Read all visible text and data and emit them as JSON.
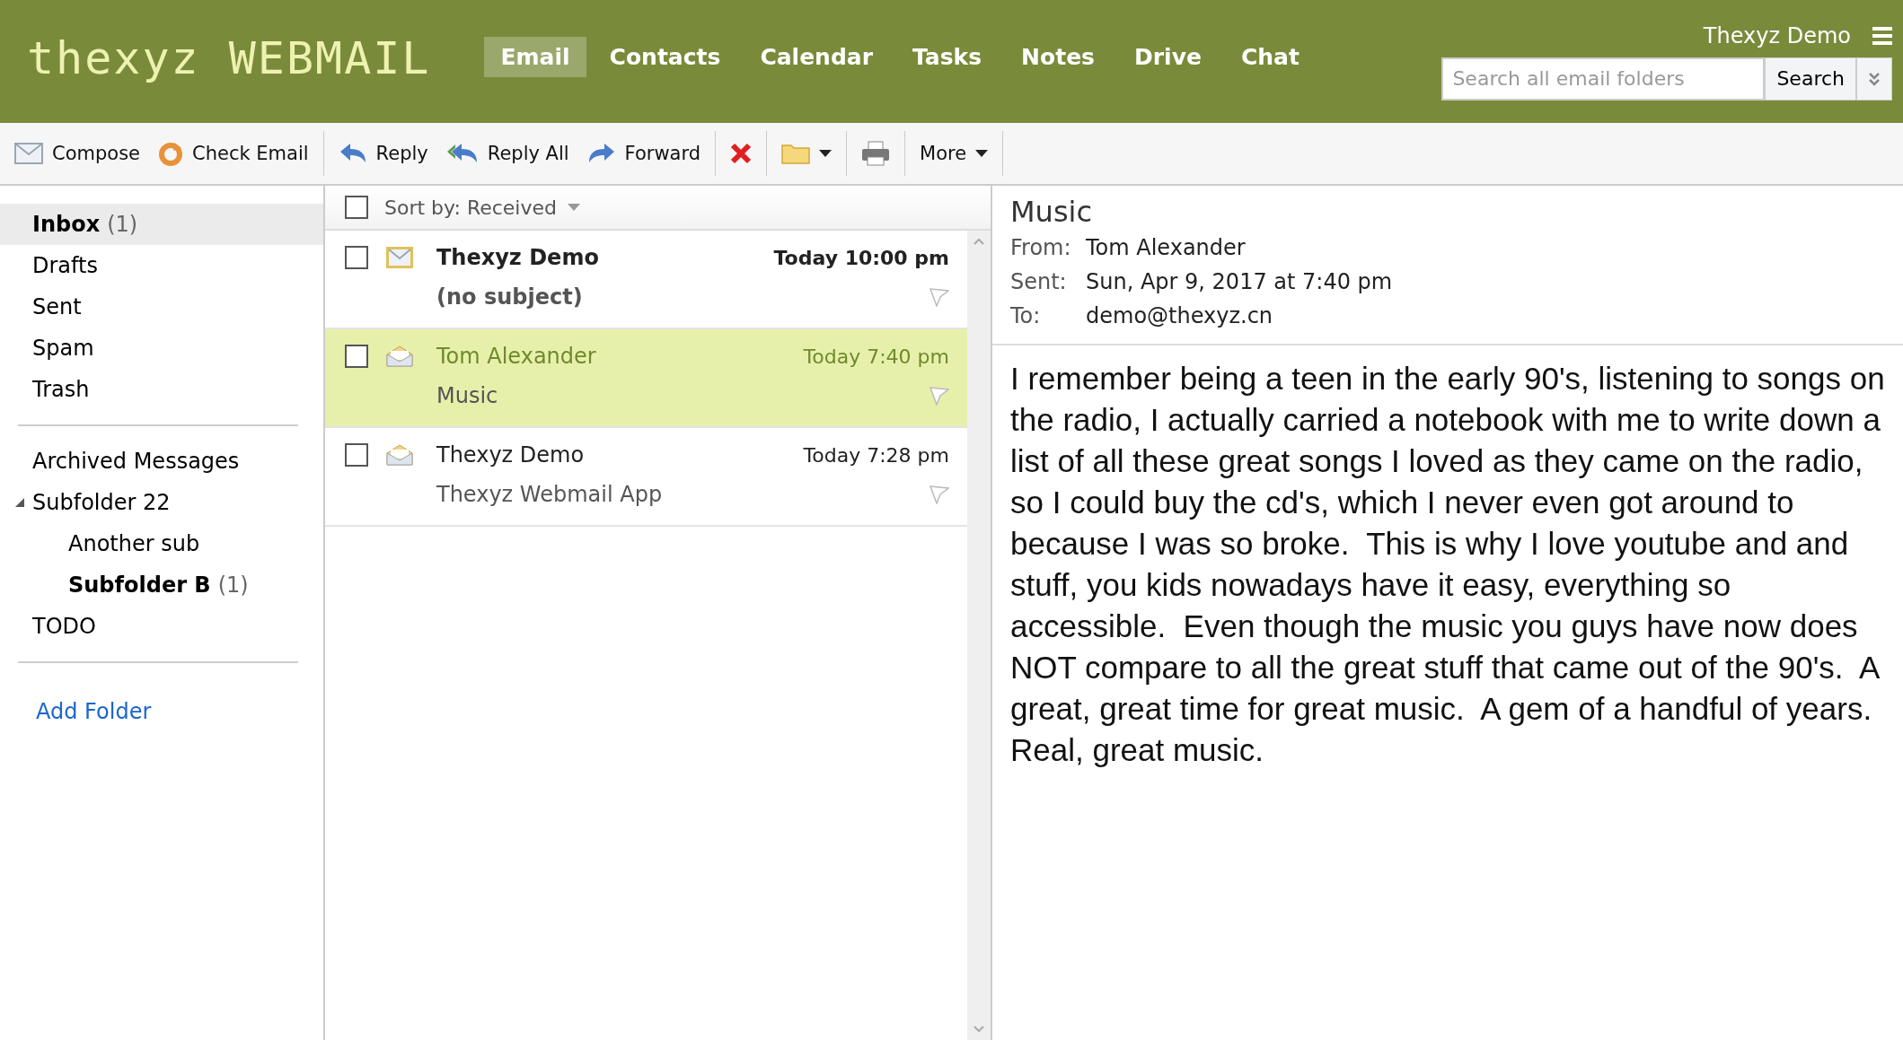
{
  "header": {
    "logo": "thexyz WEBMAIL",
    "user": "Thexyz Demo",
    "search": {
      "placeholder": "Search all email folders",
      "button": "Search"
    },
    "nav": [
      {
        "label": "Email",
        "selected": true
      },
      {
        "label": "Contacts",
        "selected": false
      },
      {
        "label": "Calendar",
        "selected": false
      },
      {
        "label": "Tasks",
        "selected": false
      },
      {
        "label": "Notes",
        "selected": false
      },
      {
        "label": "Drive",
        "selected": false
      },
      {
        "label": "Chat",
        "selected": false
      }
    ]
  },
  "toolbar": [
    {
      "kind": "compose",
      "label": "Compose"
    },
    {
      "kind": "check",
      "label": "Check Email"
    },
    {
      "kind": "sep"
    },
    {
      "kind": "reply",
      "label": "Reply"
    },
    {
      "kind": "replyall",
      "label": "Reply All"
    },
    {
      "kind": "forward",
      "label": "Forward"
    },
    {
      "kind": "sep"
    },
    {
      "kind": "delete"
    },
    {
      "kind": "sep"
    },
    {
      "kind": "move"
    },
    {
      "kind": "sep"
    },
    {
      "kind": "print"
    },
    {
      "kind": "sep"
    },
    {
      "kind": "more",
      "label": "More"
    },
    {
      "kind": "sep"
    }
  ],
  "sidebar": {
    "groups": [
      [
        {
          "name": "Inbox",
          "count": "(1)",
          "unread": true,
          "selected": true
        },
        {
          "name": "Drafts",
          "unread": false,
          "selected": false
        },
        {
          "name": "Sent",
          "unread": false,
          "selected": false
        },
        {
          "name": "Spam",
          "unread": false,
          "selected": false
        },
        {
          "name": "Trash",
          "unread": false,
          "selected": false
        }
      ],
      [
        {
          "name": "Archived Messages",
          "unread": false,
          "selected": false
        },
        {
          "name": "Subfolder 22",
          "unread": false,
          "selected": false,
          "expanded": true,
          "children": [
            {
              "name": "Another sub",
              "unread": false,
              "selected": false
            },
            {
              "name": "Subfolder B",
              "count": "(1)",
              "unread": true,
              "selected": false
            }
          ]
        },
        {
          "name": "TODO",
          "unread": false,
          "selected": false
        }
      ]
    ],
    "add_folder": "Add Folder"
  },
  "message_list": {
    "sort": "Sort by: Received",
    "all_checked": false,
    "messages": [
      {
        "from": "Thexyz Demo",
        "subject": "(no subject)",
        "time": "Today 10:00 pm",
        "unread": true,
        "selected": false,
        "checked": false
      },
      {
        "from": "Tom Alexander",
        "subject": "Music",
        "time": "Today 7:40 pm",
        "unread": false,
        "selected": true,
        "checked": false
      },
      {
        "from": "Thexyz Demo",
        "subject": "Thexyz Webmail App",
        "time": "Today 7:28 pm",
        "unread": false,
        "selected": false,
        "checked": false
      }
    ]
  },
  "reading_pane": {
    "subject": "Music",
    "fields": [
      {
        "label": "From:",
        "value": "Tom Alexander"
      },
      {
        "label": "Sent:",
        "value": "Sun, Apr 9, 2017 at 7:40 pm"
      },
      {
        "label": "To:",
        "value": "demo@thexyz.cn"
      }
    ],
    "body": "I remember being a teen in the early 90's, listening to songs on the radio, I actually carried a notebook with me to write down a list of all these great songs I loved as they came on the radio, so I could buy the cd's, which I never even got around to because I was so broke.  This is why I love youtube and and stuff, you kids nowadays have it easy, everything so accessible.  Even though the music you guys have now does NOT compare to all the great stuff that came out of the 90's.  A great, great time for great music.  A gem of a handful of years.  Real, great music."
  }
}
